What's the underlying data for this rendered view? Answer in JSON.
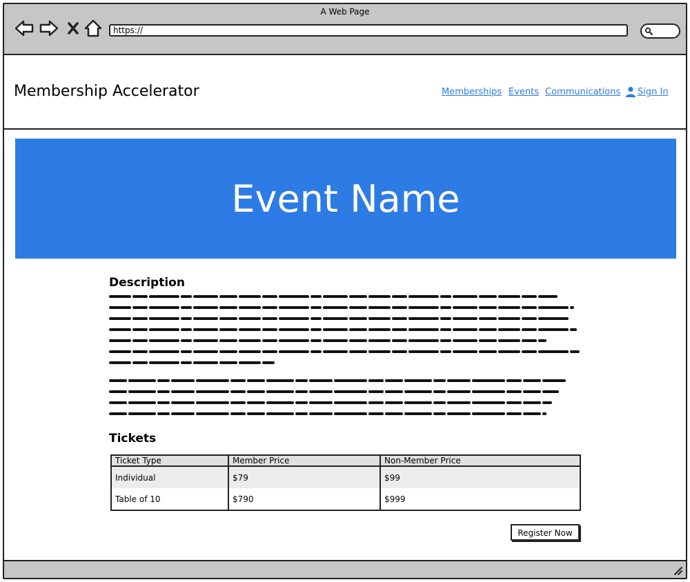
{
  "window": {
    "title": "A Web Page"
  },
  "browser": {
    "url": "https://",
    "icons": [
      "back-arrow-icon",
      "forward-arrow-icon",
      "close-x-icon",
      "home-icon",
      "search-icon",
      "resize-grip-icon"
    ]
  },
  "header": {
    "brand": "Membership Accelerator",
    "nav": {
      "memberships": "Memberships",
      "events": "Events",
      "communications": "Communications",
      "sign_in": "Sign In"
    }
  },
  "hero": {
    "title": "Event Name"
  },
  "description": {
    "heading": "Description"
  },
  "tickets": {
    "heading": "Tickets",
    "columns": [
      "Ticket Type",
      "Member Price",
      "Non-Member Price"
    ],
    "rows": [
      [
        "Individual",
        "$79",
        "$99"
      ],
      [
        "Table of 10",
        "$790",
        "$999"
      ]
    ]
  },
  "actions": {
    "register": "Register Now"
  },
  "colors": {
    "accent": "#2d7be5",
    "chrome": "#c6c6c6"
  }
}
